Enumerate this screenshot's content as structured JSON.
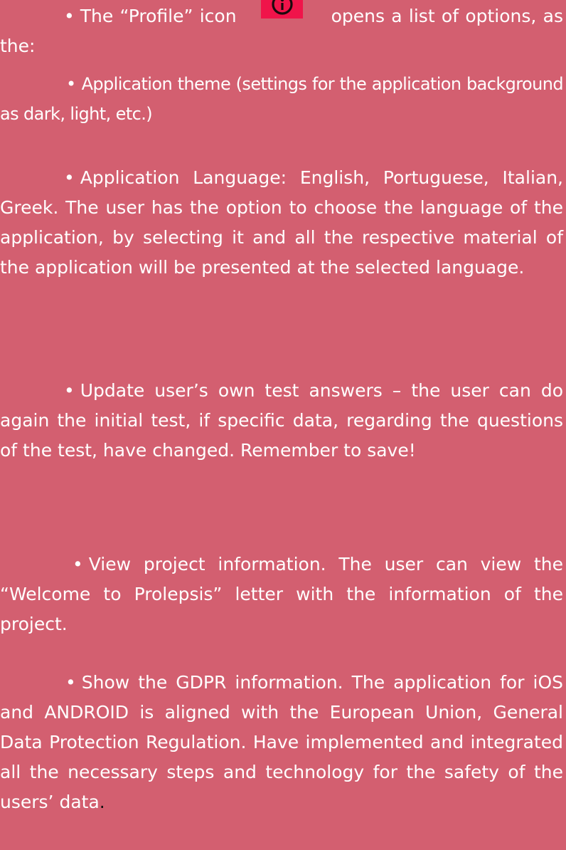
{
  "paragraphs": {
    "profile": {
      "bullet": "•",
      "before_icon": "The “Profile” icon",
      "after_icon": "opens a list of options, as the:"
    },
    "theme": {
      "bullet": "•",
      "text": "Application theme (settings for the application background as dark, light, etc.)"
    },
    "language": {
      "bullet": "•",
      "text": "Application Language: English, Portuguese, Italian, Greek. The user has the option to choose the language of the application, by selecting it and all the respective material of the application will be presented at the selected language."
    },
    "update": {
      "bullet": "•",
      "text": "Update user’s own test answers – the user can do again the initial test, if specific data, regarding the questions of the test, have changed. Remember to save!"
    },
    "project": {
      "bullet": "•",
      "text": "View project information. The user can view the “Welcome to Prolepsis” letter with the information of the project."
    },
    "gdpr": {
      "bullet": "•",
      "text": "Show the GDPR information. The application for iOS and ANDROID is aligned with the European Union, General Data Protection Regulation. Have implemented and integrated all the necessary steps and technology for the safety of the users’ data",
      "end_mark": "."
    }
  },
  "icons": {
    "profile_icon": "info-circle-icon"
  },
  "colors": {
    "background": "#d35f70",
    "text": "#ffffff",
    "icon_background": "#f0144a",
    "icon_stroke": "#1a0a0d"
  }
}
